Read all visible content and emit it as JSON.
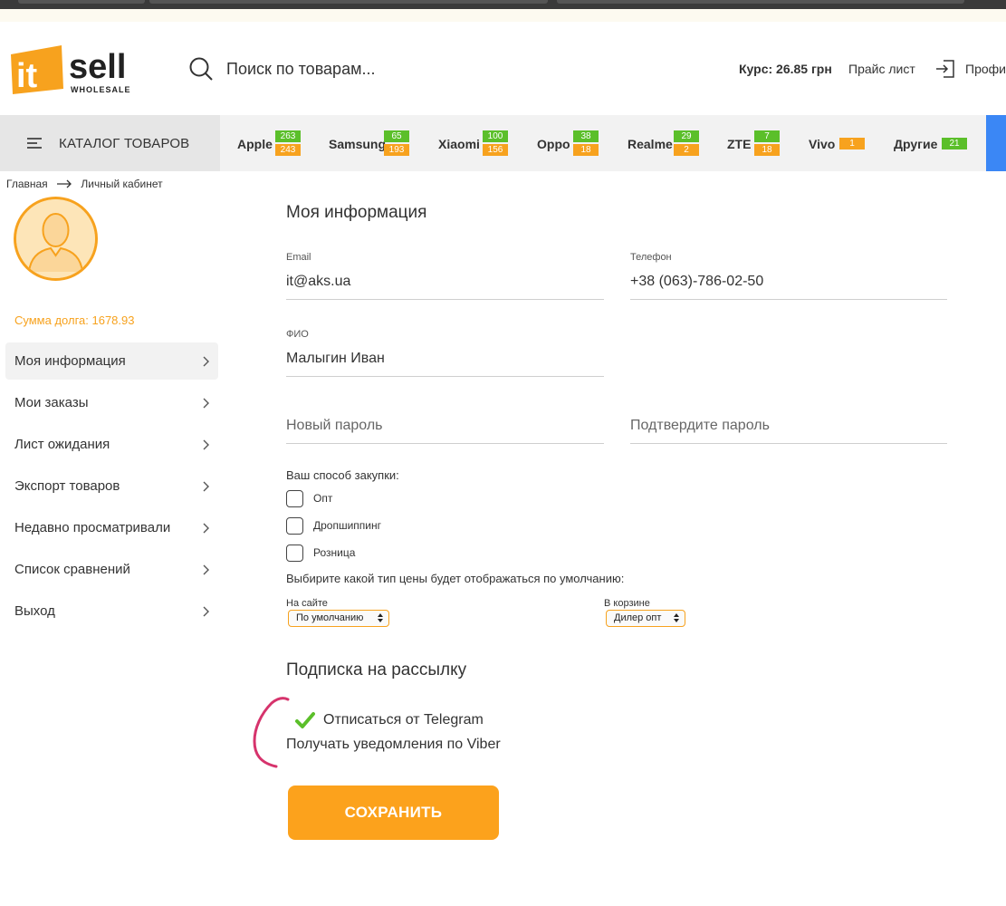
{
  "header": {
    "logo_text": "it sell",
    "logo_sub": "WHOLESALE",
    "search_placeholder": "Поиск по товарам...",
    "rate": "Курс: 26.85 грн",
    "price_list": "Прайс лист",
    "profile": "Профи"
  },
  "catalog": {
    "label": "КАТАЛОГ ТОВАРОВ",
    "brands": [
      {
        "name": "Apple",
        "badges": [
          "263",
          "243"
        ]
      },
      {
        "name": "Samsung",
        "badges": [
          "65",
          "193"
        ]
      },
      {
        "name": "Xiaomi",
        "badges": [
          "100",
          "156"
        ]
      },
      {
        "name": "Oppo",
        "badges": [
          "38",
          "18"
        ]
      },
      {
        "name": "Realme",
        "badges": [
          "29",
          "2"
        ]
      },
      {
        "name": "ZTE",
        "badges": [
          "7",
          "18"
        ]
      },
      {
        "name": "Vivo",
        "badges": [
          "1"
        ]
      },
      {
        "name": "Другие",
        "badges": [
          "21"
        ]
      }
    ]
  },
  "breadcrumb": {
    "home": "Главная",
    "current": "Личный кабинет"
  },
  "sidebar": {
    "debt": "Сумма долга: 1678.93",
    "items": [
      {
        "label": "Моя информация"
      },
      {
        "label": "Мои заказы"
      },
      {
        "label": "Лист ожидания"
      },
      {
        "label": "Экспорт товаров"
      },
      {
        "label": "Недавно просматривали"
      },
      {
        "label": "Список сравнений"
      },
      {
        "label": "Выход"
      }
    ]
  },
  "form": {
    "title": "Моя информация",
    "email_label": "Email",
    "email_value": "it@aks.ua",
    "phone_label": "Телефон",
    "phone_value": "+38 (063)-786-02-50",
    "name_label": "ФИО",
    "name_value": "Малыгин Иван",
    "new_password_placeholder": "Новый пароль",
    "confirm_password_placeholder": "Подтвердите пароль",
    "purchase_method_label": "Ваш способ закупки:",
    "purchase_options": [
      "Опт",
      "Дропшиппинг",
      "Розница"
    ],
    "price_type_label": "Выбирите какой тип цены будет отображаться по умолчанию:",
    "site_label": "На сайте",
    "site_value": "По умолчанию",
    "cart_label": "В корзине",
    "cart_value": "Дилер опт"
  },
  "subscription": {
    "title": "Подписка на рассылку",
    "telegram": "Отписаться от Telegram",
    "viber": "Получать уведомления по Viber"
  },
  "save_label": "СОХРАНИТЬ",
  "colors": {
    "accent": "#f7a21e",
    "badge_green": "#5bbf2a",
    "annotation": "#d6336c"
  }
}
